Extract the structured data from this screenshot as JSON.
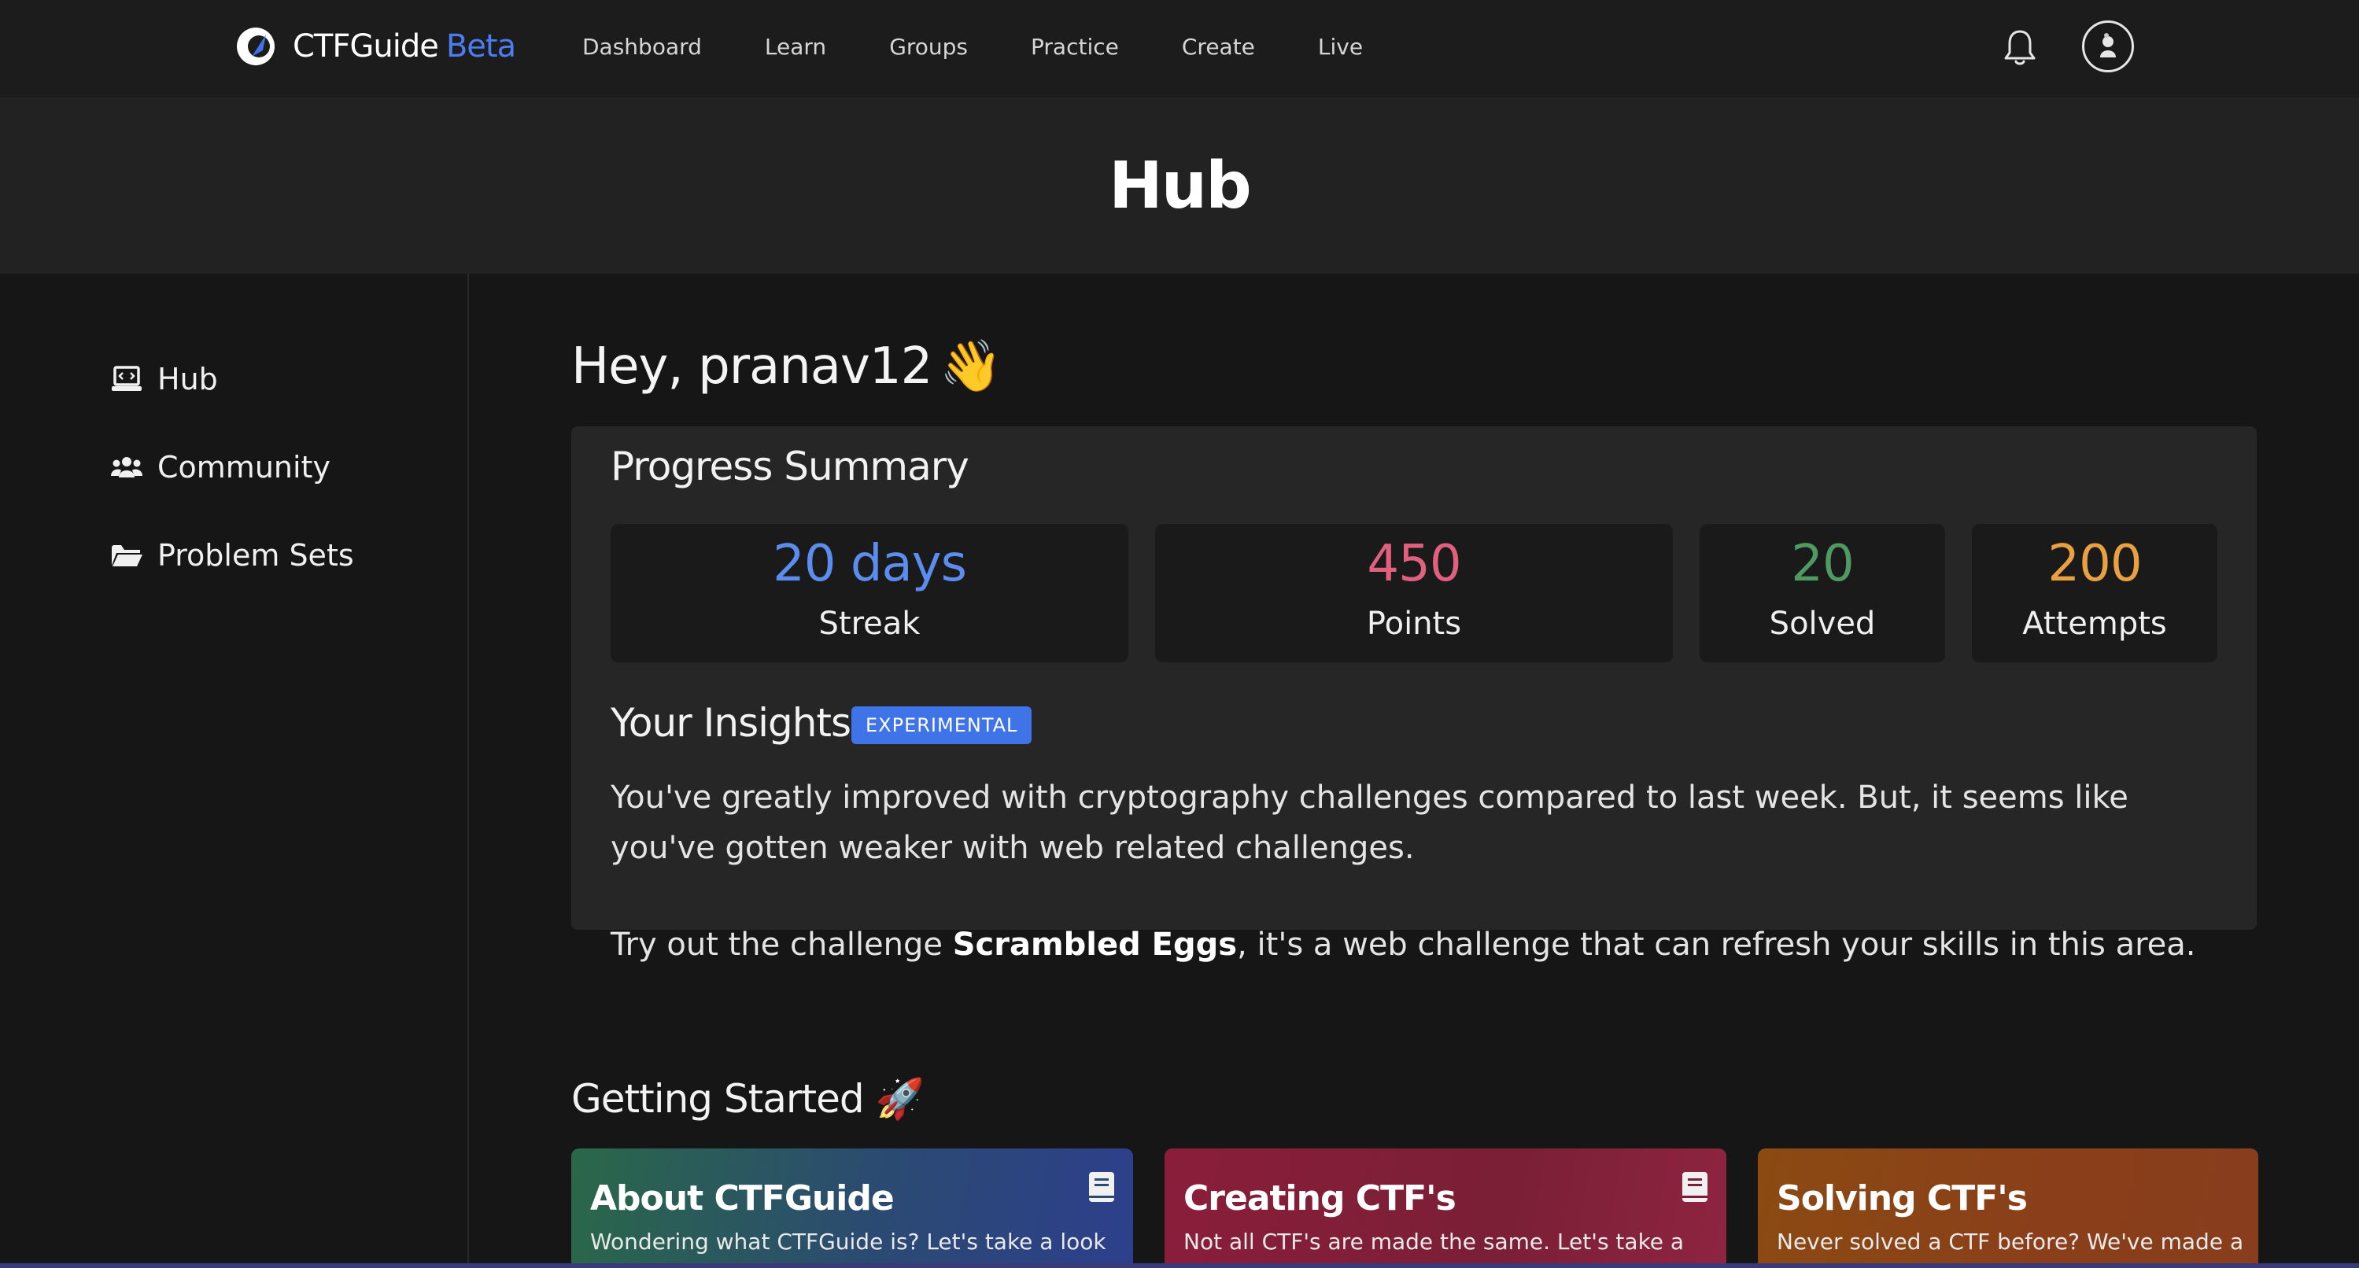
{
  "brand": {
    "name": "CTFGuide",
    "tag": "Beta"
  },
  "nav": {
    "links": [
      "Dashboard",
      "Learn",
      "Groups",
      "Practice",
      "Create",
      "Live"
    ]
  },
  "hero": {
    "title": "Hub"
  },
  "sidebar": {
    "items": [
      {
        "label": "Hub",
        "icon": "laptop-code-icon"
      },
      {
        "label": "Community",
        "icon": "users-icon"
      },
      {
        "label": "Problem Sets",
        "icon": "folder-open-icon"
      }
    ]
  },
  "greeting": {
    "text": "Hey, pranav12",
    "emoji": "👋"
  },
  "progress": {
    "title": "Progress Summary",
    "stats": [
      {
        "value": "20 days",
        "label": "Streak",
        "color": "#5b8def"
      },
      {
        "value": "450",
        "label": "Points",
        "color": "#e0607e"
      },
      {
        "value": "20",
        "label": "Solved",
        "color": "#4f9a60"
      },
      {
        "value": "200",
        "label": "Attempts",
        "color": "#e8a040"
      }
    ]
  },
  "insights": {
    "title": "Your Insights",
    "badge": "EXPERIMENTAL",
    "text1": "You've greatly improved with cryptography challenges compared to last week. But, it seems like you've gotten weaker with web related challenges.",
    "text2_prefix": "Try out the challenge ",
    "text2_bold": "Scrambled Eggs",
    "text2_suffix": ", it's a web challenge that can refresh your skills in this area."
  },
  "getting_started": {
    "title": "Getting Started",
    "emoji": "🚀",
    "cards": [
      {
        "title": "About CTFGuide",
        "desc": "Wondering what CTFGuide is? Let's take a look"
      },
      {
        "title": "Creating CTF's",
        "desc": "Not all CTF's are made the same. Let's take a"
      },
      {
        "title": "Solving CTF's",
        "desc": "Never solved a CTF before? We've made a"
      }
    ]
  }
}
